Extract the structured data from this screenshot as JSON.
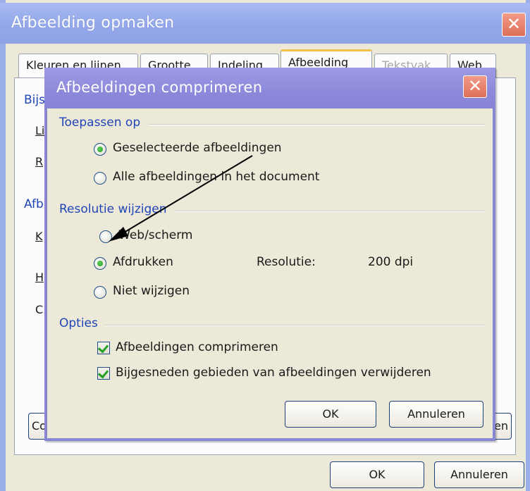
{
  "outer_dialog": {
    "title": "Afbeelding opmaken",
    "close_glyph": "✕",
    "tabs": [
      {
        "label": "Kleuren en lijnen",
        "state": "normal"
      },
      {
        "label": "Grootte",
        "state": "normal"
      },
      {
        "label": "Indeling",
        "state": "normal"
      },
      {
        "label": "Afbeelding",
        "state": "active"
      },
      {
        "label": "Tekstvak",
        "state": "disabled"
      },
      {
        "label": "Web",
        "state": "normal"
      }
    ],
    "background_peek": [
      "Bijs",
      "Li",
      "R",
      "Afb",
      "K",
      "H",
      "C",
      "Co",
      "en"
    ],
    "ok_label": "OK",
    "cancel_label": "Annuleren"
  },
  "inner_dialog": {
    "title": "Afbeeldingen comprimeren",
    "close_glyph": "✕",
    "apply_to": {
      "label": "Toepassen op",
      "options": [
        {
          "label": "Geselecteerde afbeeldingen",
          "selected": true
        },
        {
          "label": "Alle afbeeldingen in het document",
          "selected": false
        }
      ]
    },
    "resolution": {
      "label": "Resolutie wijzigen",
      "options": [
        {
          "label": "Web/scherm",
          "selected": false
        },
        {
          "label": "Afdrukken",
          "selected": true
        },
        {
          "label": "Niet wijzigen",
          "selected": false
        }
      ],
      "resolution_label": "Resolutie:",
      "resolution_value": "200 dpi"
    },
    "options": {
      "label": "Opties",
      "checkboxes": [
        {
          "label": "Afbeeldingen comprimeren",
          "checked": true
        },
        {
          "label": "Bijgesneden gebieden van afbeeldingen verwijderen",
          "checked": true
        }
      ]
    },
    "ok_label": "OK",
    "cancel_label": "Annuleren"
  },
  "colors": {
    "outer_title_bar": "#93a8ea",
    "inner_title_bar": "#8c89da",
    "group_label": "#1f45b8",
    "dialog_face": "#ece9d8",
    "close_button": "#de6f59",
    "radio_dot": "#1f9a1f",
    "check_mark": "#21a121"
  },
  "icons": {
    "close": "close-icon",
    "annotation": "arrow-annotation-icon"
  }
}
